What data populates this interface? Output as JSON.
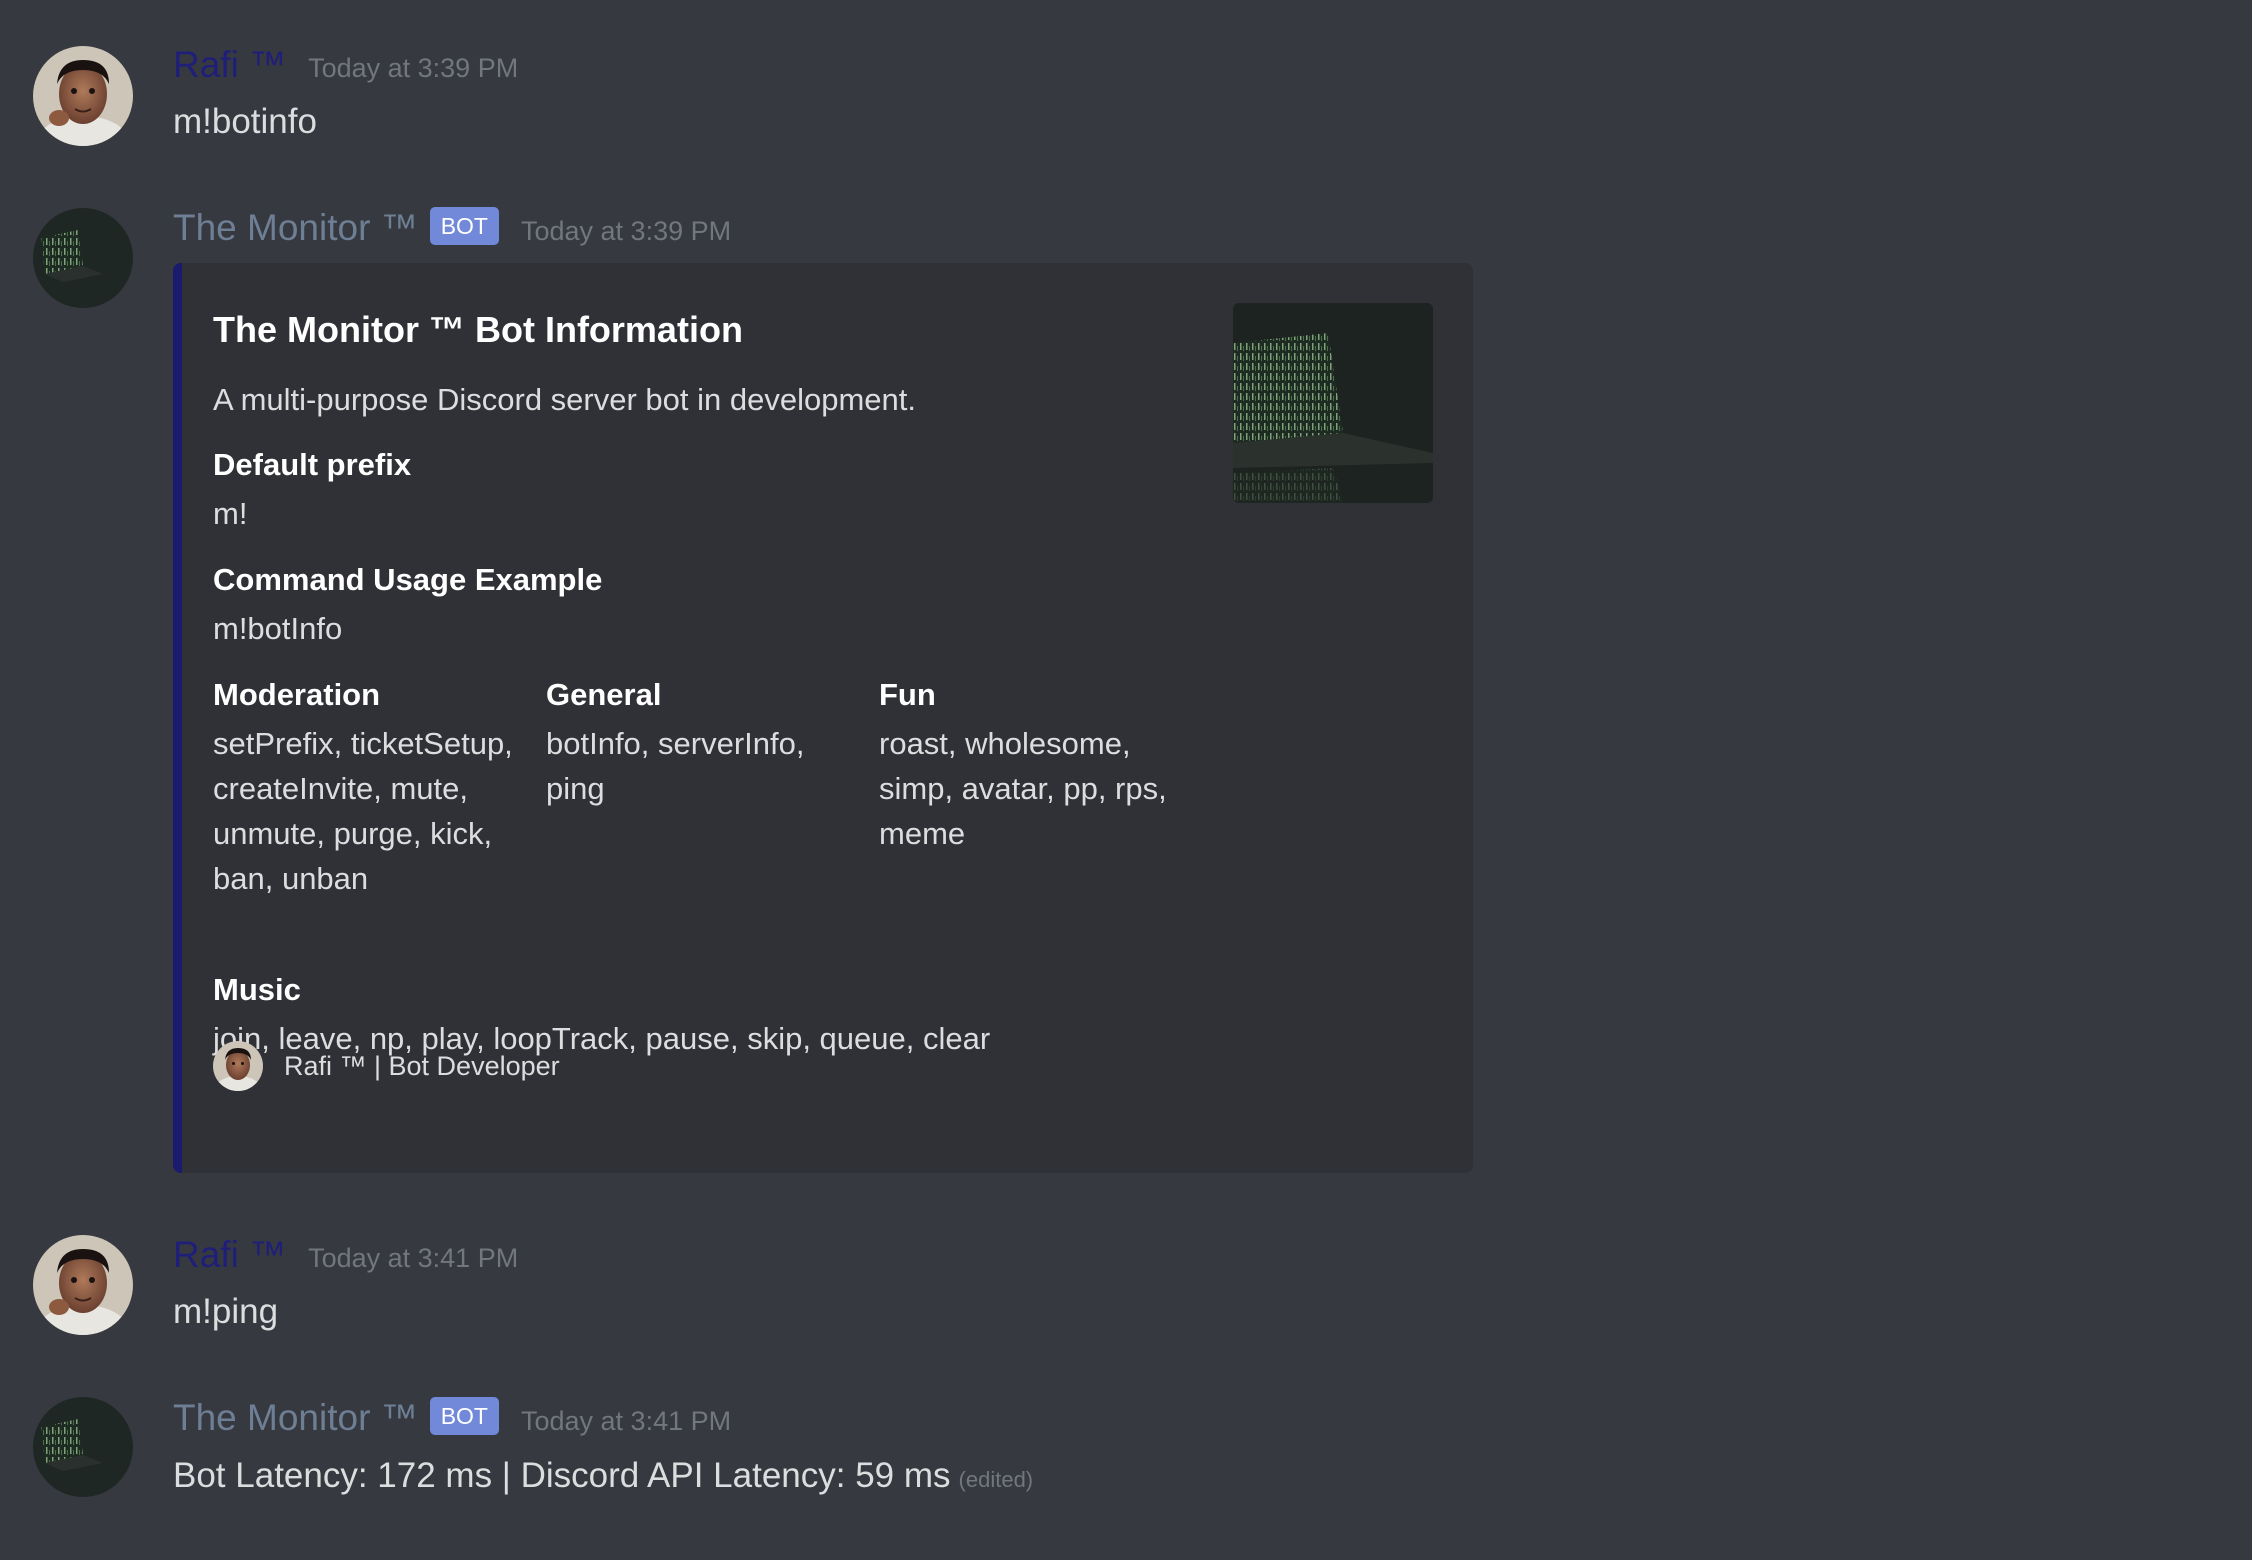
{
  "messages": [
    {
      "author": "Rafi ™",
      "timestamp": "Today at 3:39 PM",
      "text": "m!botinfo"
    },
    {
      "author": "The Monitor ™",
      "tag": "BOT",
      "timestamp": "Today at 3:39 PM",
      "embed": {
        "title": "The Monitor ™ Bot Information",
        "description": "A multi-purpose Discord server bot in development.",
        "fields": [
          {
            "name": "Default prefix",
            "value": "m!"
          },
          {
            "name": "Command Usage Example",
            "value": "m!botInfo"
          },
          {
            "name": "Moderation",
            "value": "setPrefix, ticketSetup, createInvite, mute, unmute, purge, kick, ban, unban"
          },
          {
            "name": "General",
            "value": "botInfo, serverInfo, ping"
          },
          {
            "name": "Fun",
            "value": "roast, wholesome, simp, avatar, pp, rps, meme"
          },
          {
            "name": "Music",
            "value": "join, leave, np, play, loopTrack, pause, skip, queue, clear"
          }
        ],
        "footer": "Rafi ™ | Bot Developer",
        "accent_color": "#1a1a6e"
      }
    },
    {
      "author": "Rafi ™",
      "timestamp": "Today at 3:41 PM",
      "text": "m!ping"
    },
    {
      "author": "The Monitor ™",
      "tag": "BOT",
      "timestamp": "Today at 3:41 PM",
      "text": "Bot Latency: 172 ms | Discord API Latency: 59 ms",
      "edited": "(edited)"
    }
  ],
  "colors": {
    "background": "#36393f",
    "embed_background": "#2f3136",
    "bot_tag": "#7289da",
    "user_name": "#1f1f7a",
    "bot_name": "#6e7f95"
  },
  "icons": {
    "user_avatar": "user-avatar-photo",
    "bot_avatar": "bot-avatar-matrix-laptop",
    "thumbnail": "embed-thumbnail-matrix-laptop"
  }
}
